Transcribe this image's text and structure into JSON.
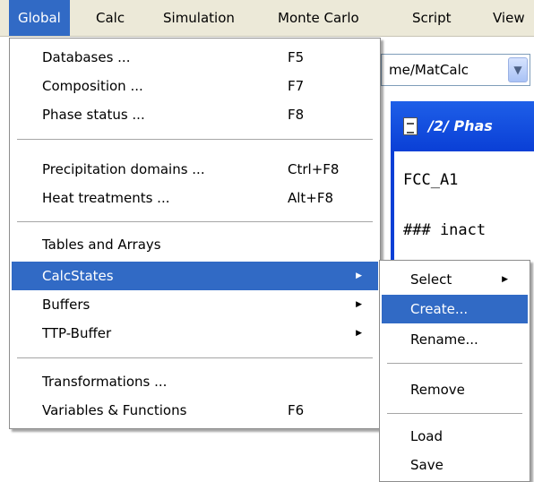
{
  "menubar": {
    "items": [
      "Global",
      "Calc",
      "Simulation",
      "Monte Carlo",
      "Script",
      "View"
    ]
  },
  "combo": {
    "value": "me/MatCalc"
  },
  "doc_window": {
    "title": "/2/ Phas",
    "lines": [
      "FCC_A1",
      "### inact"
    ]
  },
  "global_menu": {
    "items": [
      {
        "label": "Databases ...",
        "shortcut": "F5"
      },
      {
        "label": "Composition ...",
        "shortcut": "F7"
      },
      {
        "label": "Phase status ...",
        "shortcut": "F8"
      },
      {
        "label": "Precipitation domains ...",
        "shortcut": "Ctrl+F8"
      },
      {
        "label": "Heat treatments ...",
        "shortcut": "Alt+F8"
      },
      {
        "label": "Tables and Arrays",
        "shortcut": ""
      },
      {
        "label": "CalcStates",
        "shortcut": ""
      },
      {
        "label": "Buffers",
        "shortcut": ""
      },
      {
        "label": "TTP-Buffer",
        "shortcut": ""
      },
      {
        "label": "Transformations ...",
        "shortcut": ""
      },
      {
        "label": "Variables & Functions",
        "shortcut": "F6"
      }
    ]
  },
  "calcstates_submenu": {
    "items": [
      "Select",
      "Create...",
      "Rename...",
      "Remove",
      "Load",
      "Save"
    ]
  },
  "colors": {
    "highlight": "#316ac5",
    "menubar_bg": "#ece9d8",
    "window_blue": "#0a3fd6"
  },
  "icons": {
    "submenu_arrow": "triangle-right-icon",
    "combo_arrow": "chevron-down-icon",
    "doc_icon": "document-icon"
  }
}
